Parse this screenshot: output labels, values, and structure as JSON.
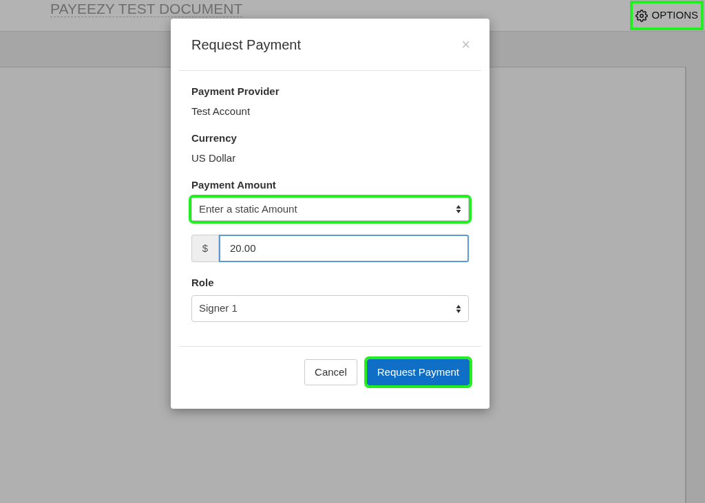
{
  "header": {
    "title": "PAYEEZY TEST DOCUMENT",
    "options": {
      "label": "OPTIONS",
      "highlighted": true
    }
  },
  "dialog": {
    "title": "Request Payment",
    "close": "×",
    "info": [
      {
        "label": "Payment Provider",
        "value": "Test Account"
      },
      {
        "label": "Currency",
        "value": "US Dollar"
      }
    ],
    "amount": {
      "label": "Payment Amount",
      "select": "Enter a static Amount",
      "highlighted": true,
      "prefix": "$",
      "value": "20.00"
    },
    "role": {
      "label": "Role",
      "select": "Signer 1"
    },
    "buttons": [
      {
        "label": "Cancel",
        "kind": "secondary",
        "highlighted": false
      },
      {
        "label": "Request Payment",
        "kind": "primary",
        "highlighted": true
      }
    ]
  }
}
